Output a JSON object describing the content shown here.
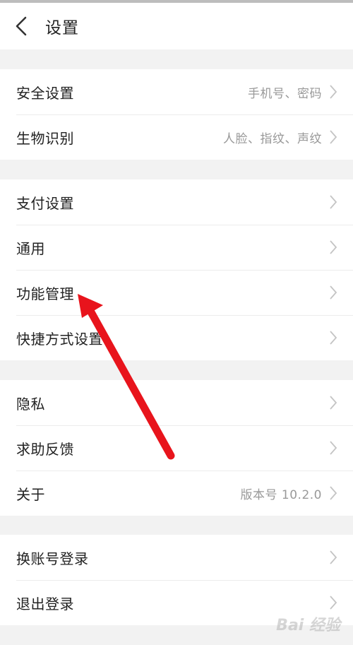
{
  "header": {
    "title": "设置"
  },
  "groups": [
    {
      "items": [
        {
          "label": "安全设置",
          "value": "手机号、密码"
        },
        {
          "label": "生物识别",
          "value": "人脸、指纹、声纹"
        }
      ]
    },
    {
      "items": [
        {
          "label": "支付设置"
        },
        {
          "label": "通用"
        },
        {
          "label": "功能管理"
        },
        {
          "label": "快捷方式设置"
        }
      ]
    },
    {
      "items": [
        {
          "label": "隐私"
        },
        {
          "label": "求助反馈"
        },
        {
          "label": "关于",
          "value": "版本号 10.2.0"
        }
      ]
    },
    {
      "items": [
        {
          "label": "换账号登录"
        },
        {
          "label": "退出登录"
        }
      ]
    }
  ],
  "watermark": "Bai 经验",
  "colors": {
    "annotation_arrow": "#e8141c",
    "background": "#f2f2f2",
    "divider": "#ececec"
  },
  "icons": {
    "back": "chevron-left-icon",
    "row": "chevron-right-icon"
  }
}
